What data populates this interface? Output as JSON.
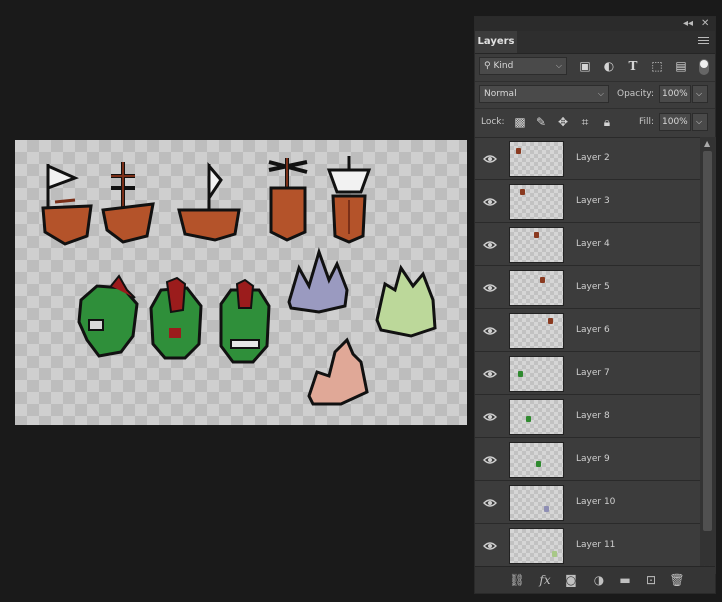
{
  "panel": {
    "title": "Layers",
    "filter_kind": "Kind",
    "blend_mode": "Normal",
    "opacity_label": "Opacity:",
    "opacity_value": "100%",
    "lock_label": "Lock:",
    "fill_label": "Fill:",
    "fill_value": "100%"
  },
  "layers": [
    {
      "name": "Layer 2",
      "thumb_color": "#8a3a20"
    },
    {
      "name": "Layer 3",
      "thumb_color": "#8a3a20"
    },
    {
      "name": "Layer 4",
      "thumb_color": "#8a3a20"
    },
    {
      "name": "Layer 5",
      "thumb_color": "#8a3a20"
    },
    {
      "name": "Layer 6",
      "thumb_color": "#8a3a20"
    },
    {
      "name": "Layer 7",
      "thumb_color": "#2f8a2f"
    },
    {
      "name": "Layer 8",
      "thumb_color": "#2f8a2f"
    },
    {
      "name": "Layer 9",
      "thumb_color": "#2f8a2f"
    },
    {
      "name": "Layer 10",
      "thumb_color": "#8e8eb4"
    },
    {
      "name": "Layer 11",
      "thumb_color": "#a8c888"
    }
  ],
  "icons": {
    "filter_row": [
      "image-filter-icon",
      "adjustment-filter-icon",
      "type-filter-icon",
      "shape-filter-icon",
      "smart-object-filter-icon"
    ],
    "lock_row": [
      "lock-transparent-pixels-icon",
      "lock-image-pixels-icon",
      "lock-position-icon",
      "lock-artboard-icon",
      "lock-all-icon"
    ],
    "footer": [
      "link-layers-icon",
      "fx-icon",
      "add-mask-icon",
      "adjustment-layer-icon",
      "new-group-icon",
      "new-layer-icon",
      "delete-layer-icon"
    ]
  },
  "colors": {
    "wood": "#b4532a",
    "wood_dark": "#7a2f18",
    "orc": "#2f8f3a",
    "orc_crest": "#9b1c1c",
    "crystal_violet": "#9a9ac0",
    "crystal_green": "#bcd89a",
    "crystal_pink": "#e0a897",
    "sail": "#f2f2f2"
  }
}
